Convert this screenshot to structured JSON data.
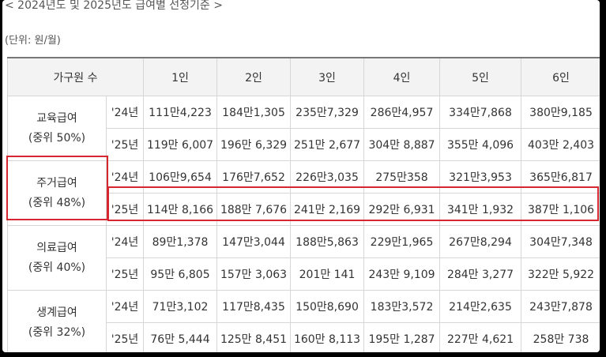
{
  "title": "< 2024년도 및 2025년도 급여별 선정기준 >",
  "unit": "(단위: 원/월)",
  "colors": {
    "highlight": "#d6262f",
    "header_bg": "#f3f3f3",
    "border": "#d6d6d6"
  },
  "table": {
    "header": {
      "group_label": "가구원 수",
      "sizes": [
        "1인",
        "2인",
        "3인",
        "4인",
        "5인",
        "6인"
      ]
    },
    "rows": [
      {
        "name": "교육급여",
        "ratio": "(중위 50%)",
        "y24": {
          "year": "'24년",
          "values": [
            "111만4,223",
            "184만1,305",
            "235만7,329",
            "286만4,957",
            "334만7,868",
            "380만9,185"
          ]
        },
        "y25": {
          "year": "'25년",
          "values": [
            "119만 6,007",
            "196만 6,329",
            "251만 2,677",
            "304만 8,887",
            "355만 4,096",
            "403만 2,403"
          ]
        }
      },
      {
        "name": "주거급여",
        "ratio": "(중위 48%)",
        "y24": {
          "year": "'24년",
          "values": [
            "106만9,654",
            "176만7,652",
            "226만3,035",
            "275만358",
            "321만3,953",
            "365만6,817"
          ]
        },
        "y25": {
          "year": "'25년",
          "values": [
            "114만 8,166",
            "188만 7,676",
            "241만 2,169",
            "292만 6,931",
            "341만 1,932",
            "387만 1,106"
          ]
        }
      },
      {
        "name": "의료급여",
        "ratio": "(중위 40%)",
        "y24": {
          "year": "'24년",
          "values": [
            "89만1,378",
            "147만3,044",
            "188만5,863",
            "229만1,965",
            "267만8,294",
            "304만7,348"
          ]
        },
        "y25": {
          "year": "'25년",
          "values": [
            "95만 6,805",
            "157만 3,063",
            "201만 141",
            "243만 9,109",
            "284만 3,277",
            "322만 5,922"
          ]
        }
      },
      {
        "name": "생계급여",
        "ratio": "(중위 32%)",
        "y24": {
          "year": "'24년",
          "values": [
            "71만3,102",
            "117만8,435",
            "150만8,690",
            "183만3,572",
            "214만2,635",
            "243만7,878"
          ]
        },
        "y25": {
          "year": "'25년",
          "values": [
            "76만 5,444",
            "125만 8,451",
            "160만 8,113",
            "195만 1,287",
            "227만 4,621",
            "258만 738"
          ]
        }
      }
    ]
  }
}
